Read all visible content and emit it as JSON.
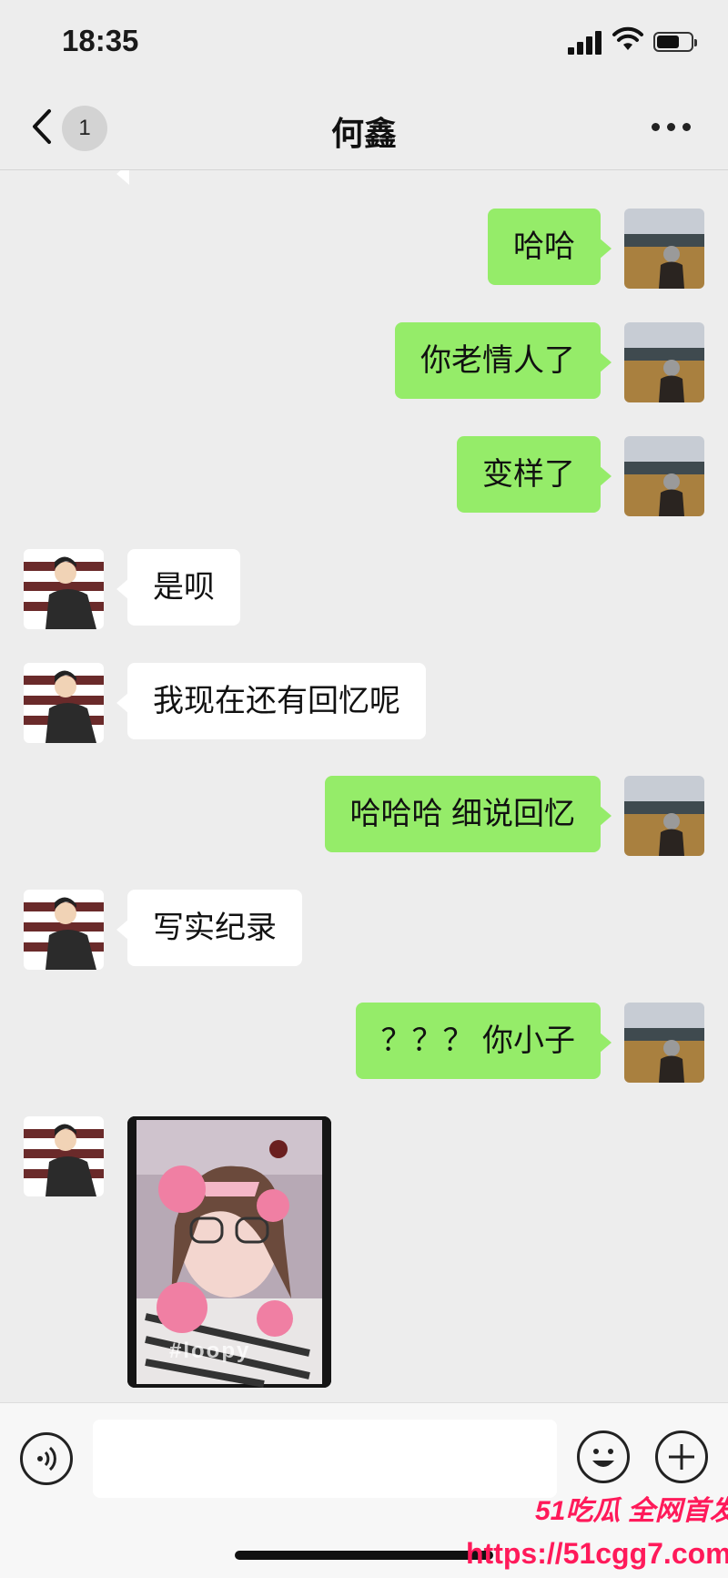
{
  "status_bar": {
    "time": "18:35"
  },
  "nav": {
    "back_badge": "1",
    "title": "何鑫"
  },
  "messages": [
    {
      "side": "right",
      "text": "哈哈"
    },
    {
      "side": "right",
      "text": "你老情人了"
    },
    {
      "side": "right",
      "text": "变样了"
    },
    {
      "side": "left",
      "text": "是呗"
    },
    {
      "side": "left",
      "text": "我现在还有回忆呢"
    },
    {
      "side": "right",
      "text": "哈哈哈 细说回忆"
    },
    {
      "side": "left",
      "text": "写实纪录"
    },
    {
      "side": "right",
      "text": "？？？ 你小子"
    },
    {
      "side": "left",
      "type": "image",
      "caption": "#loopy"
    }
  ],
  "watermark": {
    "line1": "51吃瓜 全网首发",
    "line2": "https://51cgg7.com"
  },
  "colors": {
    "sent_bubble": "#95ec69",
    "received_bubble": "#ffffff",
    "background": "#ededed",
    "watermark": "#ff1a5a"
  },
  "icons": [
    "back-arrow-icon",
    "more-icon",
    "voice-icon",
    "emoji-icon",
    "plus-icon"
  ]
}
